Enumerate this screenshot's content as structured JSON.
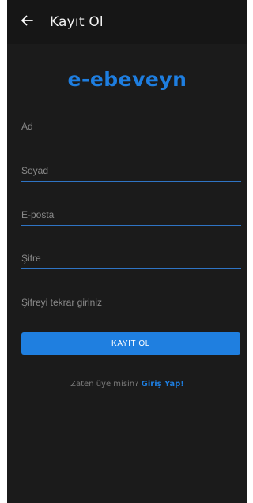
{
  "appbar": {
    "title": "Kayıt Ol",
    "back_icon": "arrow-left-icon"
  },
  "logo": {
    "text": "e-ebeveyn",
    "color": "#1e7ee0"
  },
  "form": {
    "first_name": {
      "placeholder": "Ad",
      "value": ""
    },
    "last_name": {
      "placeholder": "Soyad",
      "value": ""
    },
    "email": {
      "placeholder": "E-posta",
      "value": ""
    },
    "password": {
      "placeholder": "Şifre",
      "value": ""
    },
    "password_confirm": {
      "placeholder": "Şifreyi tekrar giriniz",
      "value": ""
    }
  },
  "submit": {
    "label": "KAYIT OL"
  },
  "footer": {
    "prompt": "Zaten üye misin?",
    "link": "Giriş Yap!"
  },
  "colors": {
    "background": "#1b1b1b",
    "appbar": "#161616",
    "accent": "#1f7fe0",
    "underline": "#2f74c4"
  }
}
